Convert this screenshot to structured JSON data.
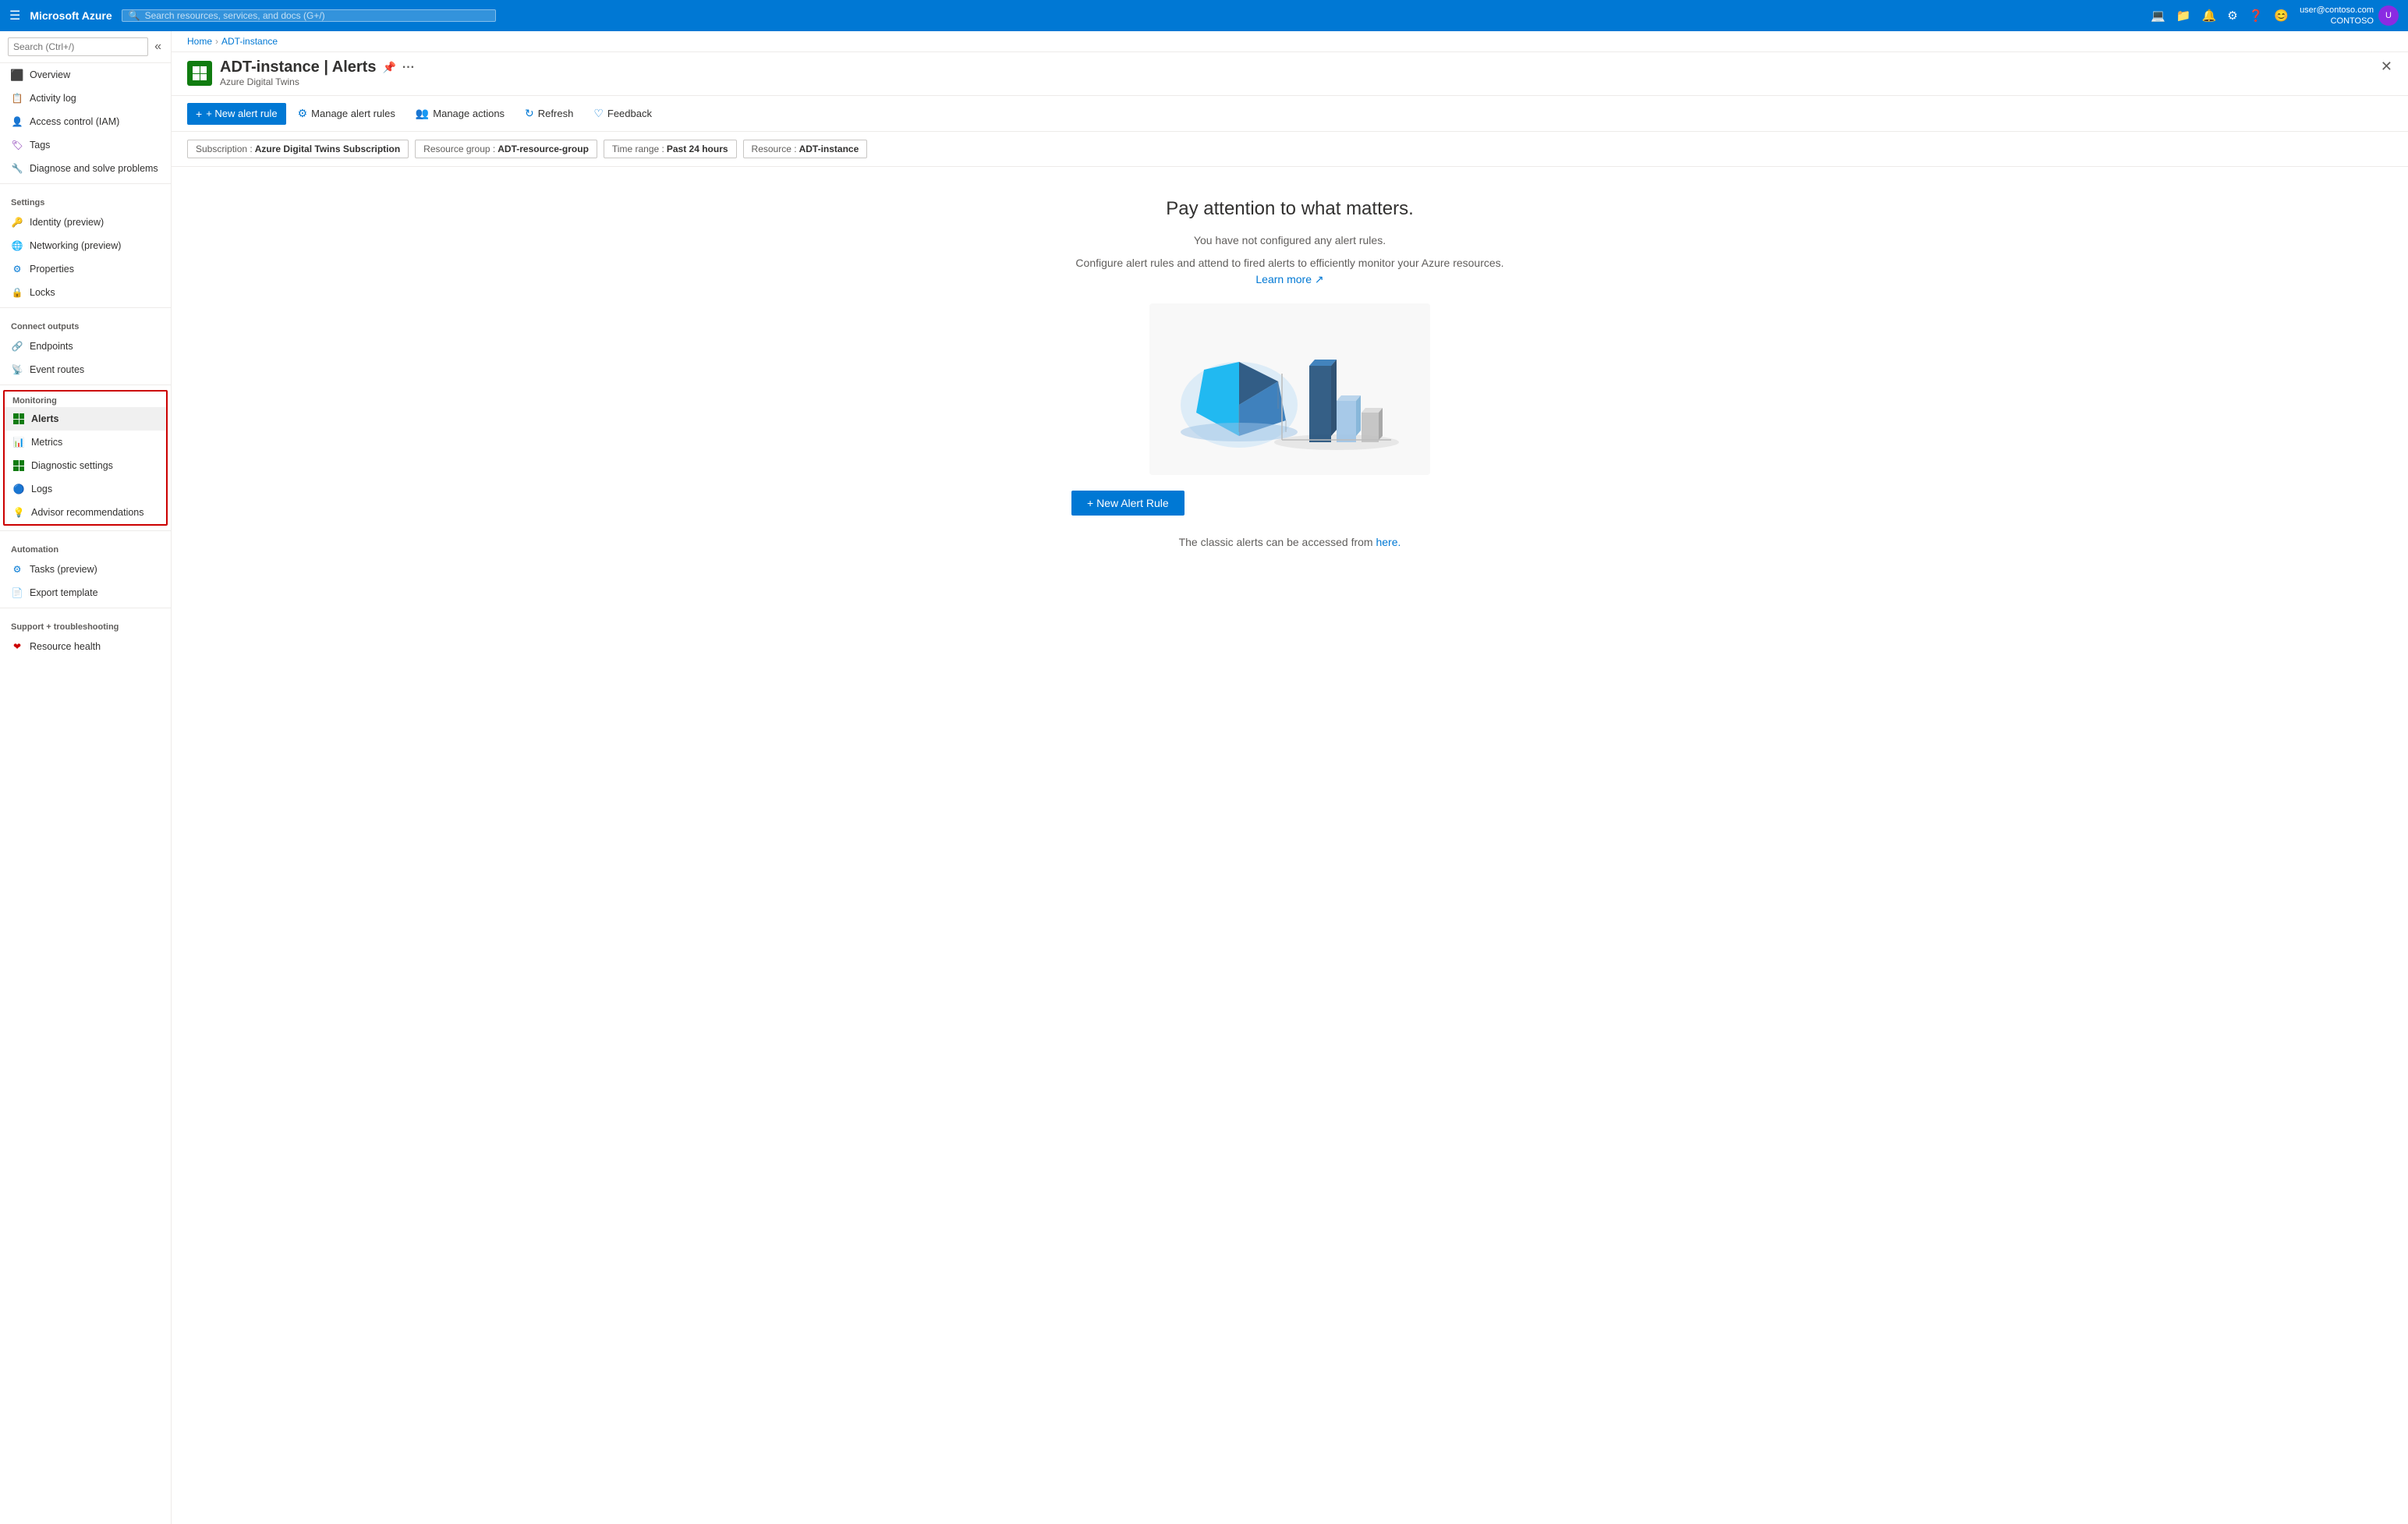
{
  "topNav": {
    "brand": "Microsoft Azure",
    "searchPlaceholder": "Search resources, services, and docs (G+/)",
    "user": {
      "name": "user@contoso.com",
      "tenant": "CONTOSO"
    }
  },
  "breadcrumb": {
    "home": "Home",
    "resource": "ADT-instance"
  },
  "pageHeader": {
    "title": "ADT-instance | Alerts",
    "subtitle": "Azure Digital Twins"
  },
  "toolbar": {
    "newAlertRule": "+ New alert rule",
    "manageAlertRules": "Manage alert rules",
    "manageActions": "Manage actions",
    "refresh": "Refresh",
    "feedback": "Feedback"
  },
  "filters": {
    "subscription": {
      "label": "Subscription : ",
      "value": "Azure Digital Twins Subscription"
    },
    "resourceGroup": {
      "label": "Resource group : ",
      "value": "ADT-resource-group"
    },
    "timeRange": {
      "label": "Time range : ",
      "value": "Past 24 hours"
    },
    "resource": {
      "label": "Resource : ",
      "value": "ADT-instance"
    }
  },
  "emptyState": {
    "heading": "Pay attention to what matters.",
    "subtext1": "You have not configured any alert rules.",
    "subtext2": "Configure alert rules and attend to fired alerts to efficiently monitor your Azure resources.",
    "learnMore": "Learn more",
    "newAlertRuleBtn": "+ New Alert Rule",
    "classicAlertText": "The classic alerts can be accessed from",
    "classicAlertLink": "here."
  },
  "sidebar": {
    "searchPlaceholder": "Search (Ctrl+/)",
    "items": [
      {
        "id": "overview",
        "label": "Overview",
        "icon": "⬛"
      },
      {
        "id": "activity-log",
        "label": "Activity log",
        "icon": "📋"
      },
      {
        "id": "access-control",
        "label": "Access control (IAM)",
        "icon": "👤"
      },
      {
        "id": "tags",
        "label": "Tags",
        "icon": "🏷"
      },
      {
        "id": "diagnose",
        "label": "Diagnose and solve problems",
        "icon": "🔧"
      }
    ],
    "sections": {
      "settings": {
        "label": "Settings",
        "items": [
          {
            "id": "identity",
            "label": "Identity (preview)",
            "icon": "🔑"
          },
          {
            "id": "networking",
            "label": "Networking (preview)",
            "icon": "🌐"
          },
          {
            "id": "properties",
            "label": "Properties",
            "icon": "⚙"
          },
          {
            "id": "locks",
            "label": "Locks",
            "icon": "🔒"
          }
        ]
      },
      "connectOutputs": {
        "label": "Connect outputs",
        "items": [
          {
            "id": "endpoints",
            "label": "Endpoints",
            "icon": "🔗"
          },
          {
            "id": "event-routes",
            "label": "Event routes",
            "icon": "📡"
          }
        ]
      },
      "monitoring": {
        "label": "Monitoring",
        "items": [
          {
            "id": "alerts",
            "label": "Alerts",
            "icon": "🟩",
            "active": true
          },
          {
            "id": "metrics",
            "label": "Metrics",
            "icon": "📊"
          },
          {
            "id": "diagnostic-settings",
            "label": "Diagnostic settings",
            "icon": "🟩"
          },
          {
            "id": "logs",
            "label": "Logs",
            "icon": "🔵"
          },
          {
            "id": "advisor",
            "label": "Advisor recommendations",
            "icon": "💡"
          }
        ]
      },
      "automation": {
        "label": "Automation",
        "items": [
          {
            "id": "tasks",
            "label": "Tasks (preview)",
            "icon": "⚙"
          },
          {
            "id": "export-template",
            "label": "Export template",
            "icon": "📄"
          }
        ]
      },
      "supportTroubleshooting": {
        "label": "Support + troubleshooting",
        "items": [
          {
            "id": "resource-health",
            "label": "Resource health",
            "icon": "❤"
          }
        ]
      }
    }
  }
}
